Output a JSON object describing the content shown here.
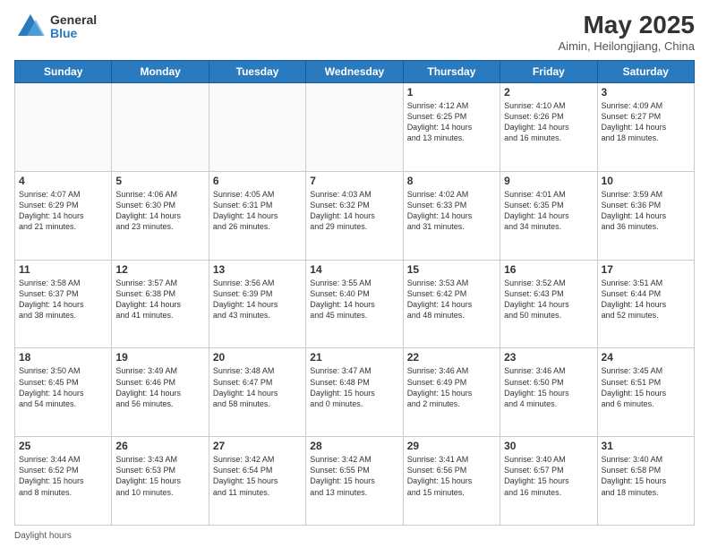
{
  "logo": {
    "general": "General",
    "blue": "Blue"
  },
  "header": {
    "month": "May 2025",
    "location": "Aimin, Heilongjiang, China"
  },
  "days": [
    "Sunday",
    "Monday",
    "Tuesday",
    "Wednesday",
    "Thursday",
    "Friday",
    "Saturday"
  ],
  "footer": {
    "daylight_label": "Daylight hours"
  },
  "weeks": [
    [
      {
        "day": "",
        "info": ""
      },
      {
        "day": "",
        "info": ""
      },
      {
        "day": "",
        "info": ""
      },
      {
        "day": "",
        "info": ""
      },
      {
        "day": "1",
        "info": "Sunrise: 4:12 AM\nSunset: 6:25 PM\nDaylight: 14 hours\nand 13 minutes."
      },
      {
        "day": "2",
        "info": "Sunrise: 4:10 AM\nSunset: 6:26 PM\nDaylight: 14 hours\nand 16 minutes."
      },
      {
        "day": "3",
        "info": "Sunrise: 4:09 AM\nSunset: 6:27 PM\nDaylight: 14 hours\nand 18 minutes."
      }
    ],
    [
      {
        "day": "4",
        "info": "Sunrise: 4:07 AM\nSunset: 6:29 PM\nDaylight: 14 hours\nand 21 minutes."
      },
      {
        "day": "5",
        "info": "Sunrise: 4:06 AM\nSunset: 6:30 PM\nDaylight: 14 hours\nand 23 minutes."
      },
      {
        "day": "6",
        "info": "Sunrise: 4:05 AM\nSunset: 6:31 PM\nDaylight: 14 hours\nand 26 minutes."
      },
      {
        "day": "7",
        "info": "Sunrise: 4:03 AM\nSunset: 6:32 PM\nDaylight: 14 hours\nand 29 minutes."
      },
      {
        "day": "8",
        "info": "Sunrise: 4:02 AM\nSunset: 6:33 PM\nDaylight: 14 hours\nand 31 minutes."
      },
      {
        "day": "9",
        "info": "Sunrise: 4:01 AM\nSunset: 6:35 PM\nDaylight: 14 hours\nand 34 minutes."
      },
      {
        "day": "10",
        "info": "Sunrise: 3:59 AM\nSunset: 6:36 PM\nDaylight: 14 hours\nand 36 minutes."
      }
    ],
    [
      {
        "day": "11",
        "info": "Sunrise: 3:58 AM\nSunset: 6:37 PM\nDaylight: 14 hours\nand 38 minutes."
      },
      {
        "day": "12",
        "info": "Sunrise: 3:57 AM\nSunset: 6:38 PM\nDaylight: 14 hours\nand 41 minutes."
      },
      {
        "day": "13",
        "info": "Sunrise: 3:56 AM\nSunset: 6:39 PM\nDaylight: 14 hours\nand 43 minutes."
      },
      {
        "day": "14",
        "info": "Sunrise: 3:55 AM\nSunset: 6:40 PM\nDaylight: 14 hours\nand 45 minutes."
      },
      {
        "day": "15",
        "info": "Sunrise: 3:53 AM\nSunset: 6:42 PM\nDaylight: 14 hours\nand 48 minutes."
      },
      {
        "day": "16",
        "info": "Sunrise: 3:52 AM\nSunset: 6:43 PM\nDaylight: 14 hours\nand 50 minutes."
      },
      {
        "day": "17",
        "info": "Sunrise: 3:51 AM\nSunset: 6:44 PM\nDaylight: 14 hours\nand 52 minutes."
      }
    ],
    [
      {
        "day": "18",
        "info": "Sunrise: 3:50 AM\nSunset: 6:45 PM\nDaylight: 14 hours\nand 54 minutes."
      },
      {
        "day": "19",
        "info": "Sunrise: 3:49 AM\nSunset: 6:46 PM\nDaylight: 14 hours\nand 56 minutes."
      },
      {
        "day": "20",
        "info": "Sunrise: 3:48 AM\nSunset: 6:47 PM\nDaylight: 14 hours\nand 58 minutes."
      },
      {
        "day": "21",
        "info": "Sunrise: 3:47 AM\nSunset: 6:48 PM\nDaylight: 15 hours\nand 0 minutes."
      },
      {
        "day": "22",
        "info": "Sunrise: 3:46 AM\nSunset: 6:49 PM\nDaylight: 15 hours\nand 2 minutes."
      },
      {
        "day": "23",
        "info": "Sunrise: 3:46 AM\nSunset: 6:50 PM\nDaylight: 15 hours\nand 4 minutes."
      },
      {
        "day": "24",
        "info": "Sunrise: 3:45 AM\nSunset: 6:51 PM\nDaylight: 15 hours\nand 6 minutes."
      }
    ],
    [
      {
        "day": "25",
        "info": "Sunrise: 3:44 AM\nSunset: 6:52 PM\nDaylight: 15 hours\nand 8 minutes."
      },
      {
        "day": "26",
        "info": "Sunrise: 3:43 AM\nSunset: 6:53 PM\nDaylight: 15 hours\nand 10 minutes."
      },
      {
        "day": "27",
        "info": "Sunrise: 3:42 AM\nSunset: 6:54 PM\nDaylight: 15 hours\nand 11 minutes."
      },
      {
        "day": "28",
        "info": "Sunrise: 3:42 AM\nSunset: 6:55 PM\nDaylight: 15 hours\nand 13 minutes."
      },
      {
        "day": "29",
        "info": "Sunrise: 3:41 AM\nSunset: 6:56 PM\nDaylight: 15 hours\nand 15 minutes."
      },
      {
        "day": "30",
        "info": "Sunrise: 3:40 AM\nSunset: 6:57 PM\nDaylight: 15 hours\nand 16 minutes."
      },
      {
        "day": "31",
        "info": "Sunrise: 3:40 AM\nSunset: 6:58 PM\nDaylight: 15 hours\nand 18 minutes."
      }
    ]
  ]
}
